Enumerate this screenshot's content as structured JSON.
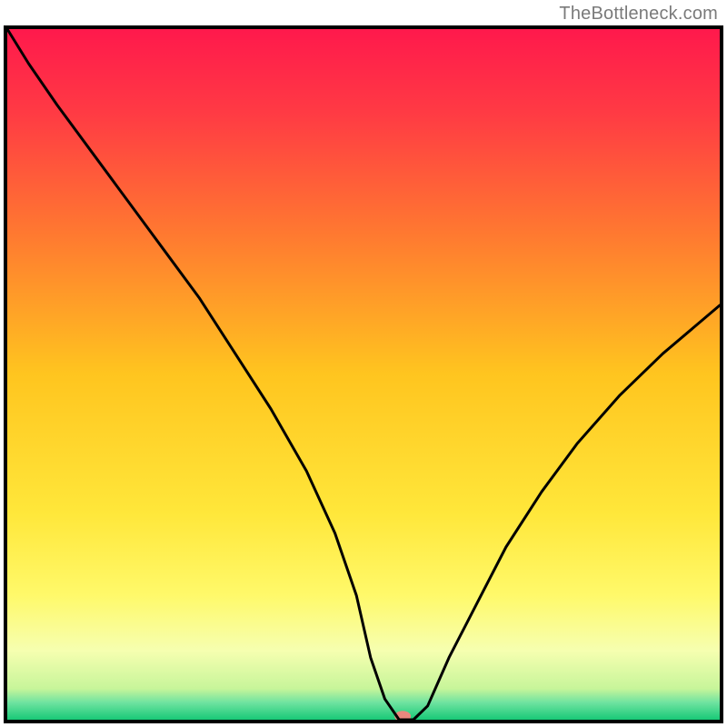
{
  "watermark": "TheBottleneck.com",
  "chart_data": {
    "type": "line",
    "title": "",
    "xlabel": "",
    "ylabel": "",
    "xlim": [
      0,
      100
    ],
    "ylim": [
      0,
      100
    ],
    "background": {
      "type": "vertical-gradient",
      "stops": [
        {
          "offset": 0.0,
          "color": "#ff194c"
        },
        {
          "offset": 0.12,
          "color": "#ff3a44"
        },
        {
          "offset": 0.3,
          "color": "#ff7a30"
        },
        {
          "offset": 0.5,
          "color": "#ffc51f"
        },
        {
          "offset": 0.7,
          "color": "#ffe73a"
        },
        {
          "offset": 0.82,
          "color": "#fff96a"
        },
        {
          "offset": 0.9,
          "color": "#f6ffb0"
        },
        {
          "offset": 0.955,
          "color": "#c7f59a"
        },
        {
          "offset": 0.975,
          "color": "#6fe3a0"
        },
        {
          "offset": 1.0,
          "color": "#18c977"
        }
      ]
    },
    "series": [
      {
        "name": "bottleneck-curve",
        "color": "#000000",
        "stroke_width": 3,
        "x": [
          0,
          3,
          7,
          12,
          17,
          22,
          27,
          32,
          37,
          42,
          46,
          49,
          51,
          53,
          55,
          57,
          59,
          62,
          66,
          70,
          75,
          80,
          86,
          92,
          100
        ],
        "values": [
          100,
          95,
          89,
          82,
          75,
          68,
          61,
          53,
          45,
          36,
          27,
          18,
          9,
          3,
          0,
          0,
          2,
          9,
          17,
          25,
          33,
          40,
          47,
          53,
          60
        ]
      }
    ],
    "marker": {
      "x": 55.5,
      "y": 0.5,
      "rx": 9,
      "ry": 6,
      "fill": "#e9887e"
    },
    "axes": {
      "show_ticks": false,
      "show_grid": false,
      "border_color": "#000000",
      "border_width": 4
    }
  }
}
